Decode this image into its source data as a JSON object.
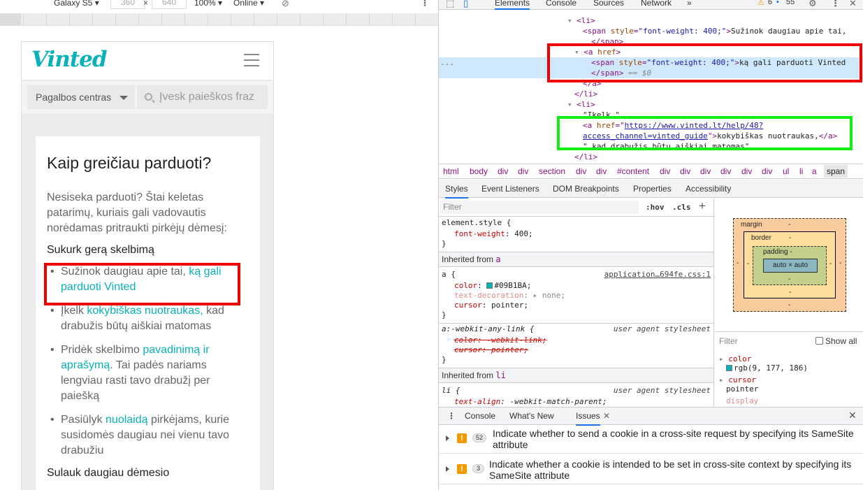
{
  "device_toolbar": {
    "device": "Galaxy S5 ▾",
    "width": "360",
    "times": "×",
    "height": "640",
    "zoom": "100% ▾",
    "network": "Online ▾"
  },
  "page": {
    "logo": "Vinted",
    "help_select": "Pagalbos centras",
    "search_placeholder": "Įvesk paieškos fraz",
    "title": "Kaip greičiau parduoti?",
    "intro": "Nesiseka parduoti? Štai keletas patarimų, kuriais gali vadovautis norėdamas pritraukti pirkėjų dėmesį:",
    "section1": "Sukurk gerą skelbimą",
    "items": [
      {
        "pre": "Sužinok daugiau apie tai, ",
        "link": "ką gali parduoti Vinted",
        "post": ""
      },
      {
        "pre": "Įkelk ",
        "link": "kokybiškas nuotraukas,",
        "post": " kad drabužis būtų aiškiai matomas"
      },
      {
        "pre": "Pridėk skelbimo ",
        "link": "pavadinimą ir aprašymą",
        "post": ". Tai padės nariams lengviau rasti tavo drabužį per paiešką"
      },
      {
        "pre": "Pasiūlyk ",
        "link": "nuolaidą",
        "post": " pirkėjams, kurie susidomės daugiau nei vienu tavo drabužiu"
      }
    ],
    "section2": "Sulauk daugiau dėmesio"
  },
  "devtools": {
    "tabs": [
      "Elements",
      "Console",
      "Sources",
      "Network",
      "»"
    ],
    "active_tab": "Elements",
    "warnings_count": "6",
    "messages_count": "55",
    "dom": {
      "l1": "<li>",
      "l2_tag_open": "<span ",
      "l2_attr": "style",
      "l2_val": "\"font-weight: 400;\"",
      "l2_text": "Sužinok daugiau apie tai,",
      "l3": "</span>",
      "l4_tag": "<a ",
      "l4_attr": "href",
      "l4_end": ">",
      "l5_text": "ką gali parduoti Vinted",
      "l6": "</span>",
      "l6_eq": " == $0",
      "l7": "</a>",
      "l8": "</li>",
      "l9": "<li>",
      "l10": "\"Įkelk \"",
      "l11_url": "https://www.vinted.lt/help/48?",
      "l12_url": "access_channel=vinted_guide",
      "l12_text": "kokybiškas nuotraukas,",
      "l12_close": "</a>",
      "l13": "\" kad drabužis būtų aiškiai matomas\"",
      "l14": "</li>",
      "ellipsis": "..."
    },
    "breadcrumbs": [
      "html",
      "body",
      "div",
      "div",
      "section",
      "div",
      "div",
      "#content",
      "div",
      "div",
      "div",
      "div",
      "div",
      "div",
      "ul",
      "li",
      "a",
      "span"
    ],
    "sub_tabs": [
      "Styles",
      "Event Listeners",
      "DOM Breakpoints",
      "Properties",
      "Accessibility"
    ],
    "styles": {
      "filter_placeholder": "Filter",
      "hov": ":hov",
      "cls": ".cls",
      "element_style": "element.style {",
      "fw_prop": "font-weight",
      "fw_val": "400",
      "inherited_a": "Inherited from ",
      "inherited_a_tag": "a",
      "a_selector": "a {",
      "a_source": "application…694fe.css:1",
      "color_prop": "color",
      "color_val": "#09B1BA",
      "td_prop": "text-decoration",
      "td_val": "none",
      "cursor_prop": "cursor",
      "cursor_val": "pointer",
      "webkit_selector": "a:-webkit-any-link {",
      "ua_label": "user agent stylesheet",
      "wk_color": "color: -webkit-link;",
      "wk_cursor": "cursor: pointer;",
      "inherited_li": "Inherited from ",
      "inherited_li_tag": "li",
      "li_selector": "li {",
      "li_prop": "text-align",
      "li_val": "-webkit-match-parent"
    },
    "boxmodel": {
      "margin": "margin",
      "border": "border",
      "padding": "padding -",
      "content": "auto × auto",
      "dash": "-"
    },
    "computed": {
      "filter": "Filter",
      "show_all": "Show all",
      "color_prop": "color",
      "color_val": "rgb(9, 177, 186)",
      "cursor_prop": "cursor",
      "cursor_val": "pointer",
      "display_prop": "display"
    },
    "drawer_tabs": [
      "Console",
      "What's New",
      "Issues"
    ],
    "issues": [
      {
        "count": "52",
        "text": "Indicate whether to send a cookie in a cross-site request by specifying its SameSite attribute"
      },
      {
        "count": "3",
        "text": "Indicate whether a cookie is intended to be set in cross-site context by specifying its SameSite attribute"
      }
    ]
  },
  "colors": {
    "brand": "#09B1BA",
    "highlight_red": "#EE0000",
    "highlight_green": "#11EE11"
  }
}
